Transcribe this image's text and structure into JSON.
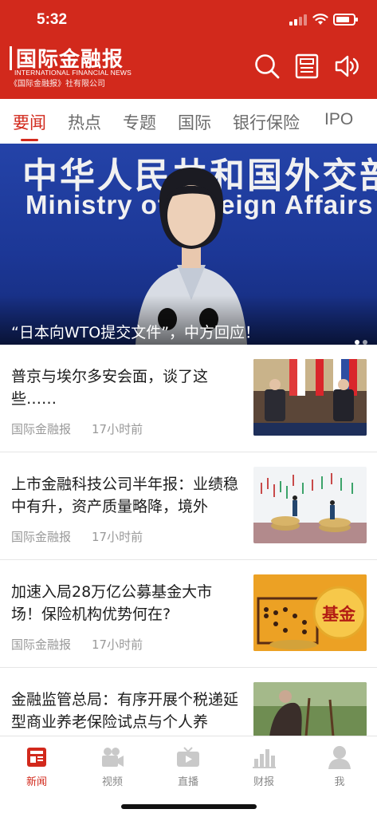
{
  "status_bar": {
    "time": "5:32",
    "battery_level": 0.8,
    "signal_bars": 2
  },
  "header": {
    "logo_cn": "国际金融报",
    "logo_en": "INTERNATIONAL FINANCIAL NEWS",
    "logo_sub": "《国际金融报》社有限公司",
    "icons": [
      "search-icon",
      "newspaper-icon",
      "audio-icon"
    ]
  },
  "tabs": [
    {
      "label": "要闻",
      "active": true
    },
    {
      "label": "热点",
      "active": false
    },
    {
      "label": "专题",
      "active": false
    },
    {
      "label": "国际",
      "active": false
    },
    {
      "label": "银行保险",
      "active": false
    },
    {
      "label": "IPO",
      "active": false
    }
  ],
  "hero": {
    "sign_cn": "中华人民共和国外交部",
    "sign_en": "Ministry of Foreign Affairs",
    "caption": "“日本向WTO提交文件”，中方回应！",
    "dots": 2,
    "active_dot": 1
  },
  "news": [
    {
      "title": "普京与埃尔多安会面，谈了这些……",
      "source": "国际金融报",
      "time": "17小时前",
      "thumb": "meeting-photo"
    },
    {
      "title": "上市金融科技公司半年报：业绩稳中有升，资产质量略降，境外",
      "source": "国际金融报",
      "time": "17小时前",
      "thumb": "coins-chart-photo"
    },
    {
      "title": "加速入局28万亿公募基金大市场！保险机构优势何在?",
      "source": "国际金融报",
      "time": "17小时前",
      "thumb": "fund-abacus-photo",
      "thumb_text": "基金"
    },
    {
      "title": "金融监管总局：有序开展个税递延型商业养老保险试点与个人养",
      "source": "",
      "time": "",
      "thumb": "elderly-photo"
    }
  ],
  "tabbar": [
    {
      "label": "新闻",
      "icon": "news-icon",
      "active": true
    },
    {
      "label": "视频",
      "icon": "video-camera-icon",
      "active": false
    },
    {
      "label": "直播",
      "icon": "tv-icon",
      "active": false
    },
    {
      "label": "财报",
      "icon": "bar-chart-icon",
      "active": false
    },
    {
      "label": "我",
      "icon": "user-icon",
      "active": false
    }
  ],
  "colors": {
    "brand_red": "#d2291c",
    "inactive": "#888888"
  }
}
